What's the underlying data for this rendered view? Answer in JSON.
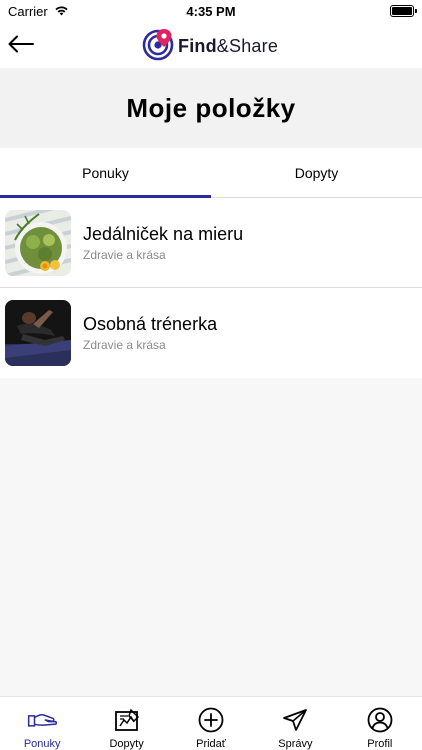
{
  "status_bar": {
    "carrier": "Carrier",
    "time": "4:35 PM"
  },
  "nav": {
    "brand_bold": "Find",
    "brand_rest": "&Share",
    "back_icon": "arrow-left-icon"
  },
  "page": {
    "title": "Moje položky"
  },
  "tabs": [
    {
      "label": "Ponuky",
      "active": true
    },
    {
      "label": "Dopyty",
      "active": false
    }
  ],
  "items": [
    {
      "title": "Jedálniček na mieru",
      "category": "Zdravie a krása",
      "thumb": "salad-photo"
    },
    {
      "title": "Osobná trénerka",
      "category": "Zdravie a krása",
      "thumb": "fitness-photo"
    }
  ],
  "tab_bar": [
    {
      "label": "Ponuky",
      "icon": "handshake-icon",
      "active": true
    },
    {
      "label": "Dopyty",
      "icon": "easel-icon",
      "active": false
    },
    {
      "label": "Pridať",
      "icon": "plus-circle-icon",
      "active": false
    },
    {
      "label": "Správy",
      "icon": "paper-plane-icon",
      "active": false
    },
    {
      "label": "Profil",
      "icon": "user-icon",
      "active": false
    }
  ],
  "colors": {
    "accent": "#2b2b9e",
    "subtext": "#8a8a8a",
    "background": "#f7f7f7"
  }
}
